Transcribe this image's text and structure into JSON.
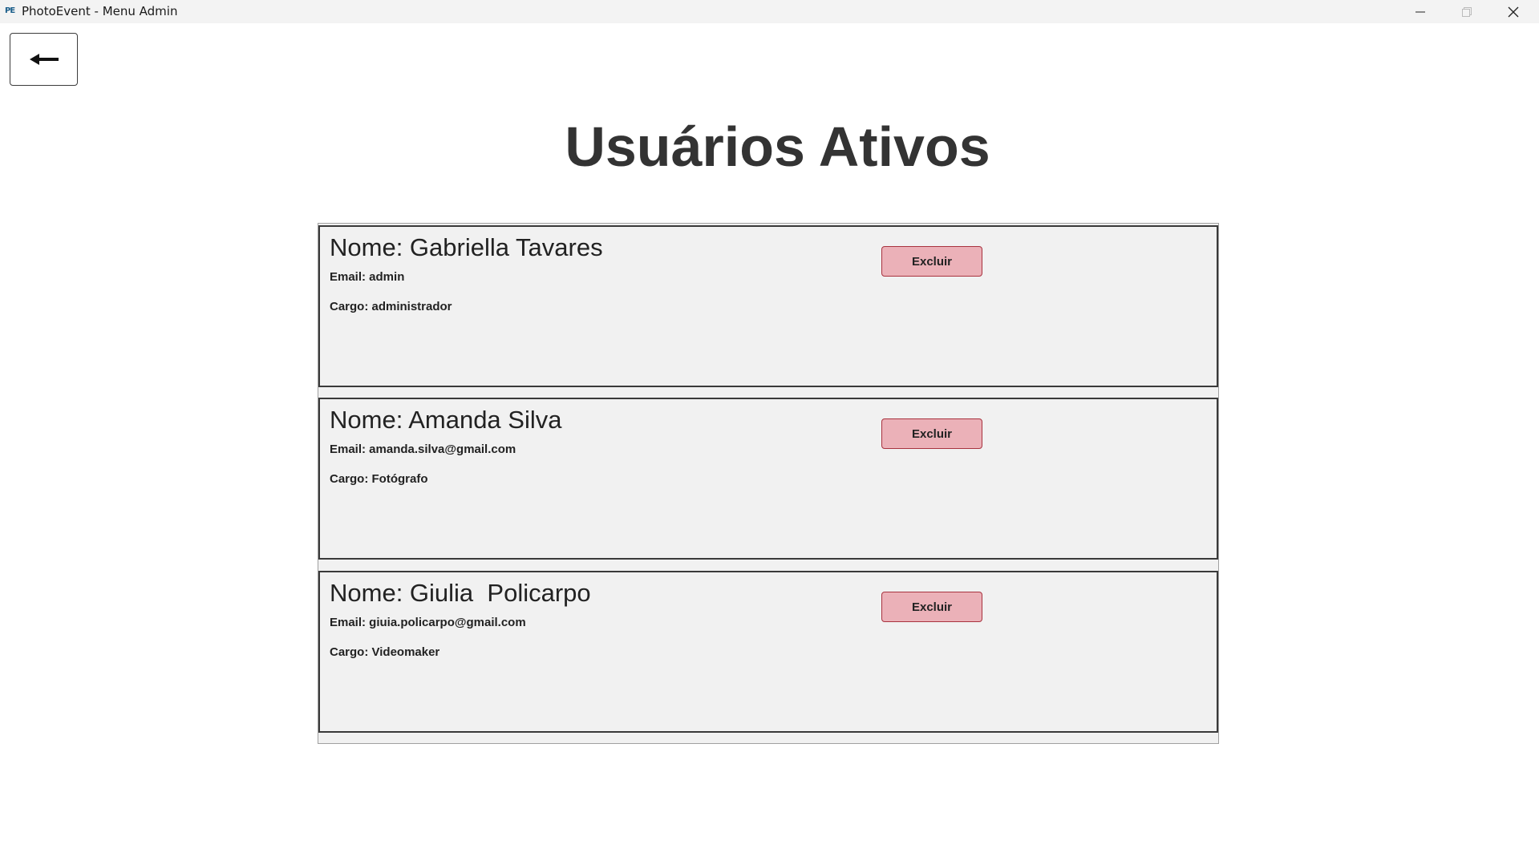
{
  "window": {
    "app_icon_text": "PE",
    "title": "PhotoEvent - Menu Admin"
  },
  "icons": {
    "back": "arrow-left-icon",
    "minimize": "minimize-icon",
    "maximize": "maximize-icon",
    "close": "close-icon"
  },
  "page": {
    "title": "Usuários Ativos"
  },
  "users": [
    {
      "name": "Nome: Gabriella Tavares",
      "email": "Email: admin",
      "role": "Cargo: administrador",
      "delete_label": "Excluir"
    },
    {
      "name": "Nome: Amanda Silva",
      "email": "Email: amanda.silva@gmail.com",
      "role": "Cargo: Fotógrafo",
      "delete_label": "Excluir"
    },
    {
      "name": "Nome: Giulia  Policarpo",
      "email": "Email: giuia.policarpo@gmail.com",
      "role": "Cargo: Videomaker",
      "delete_label": "Excluir"
    }
  ],
  "colors": {
    "delete_button_bg": "#ebb1b8",
    "delete_button_border": "#a8333f",
    "card_bg": "#f1f1f1",
    "title_text": "#333333"
  }
}
